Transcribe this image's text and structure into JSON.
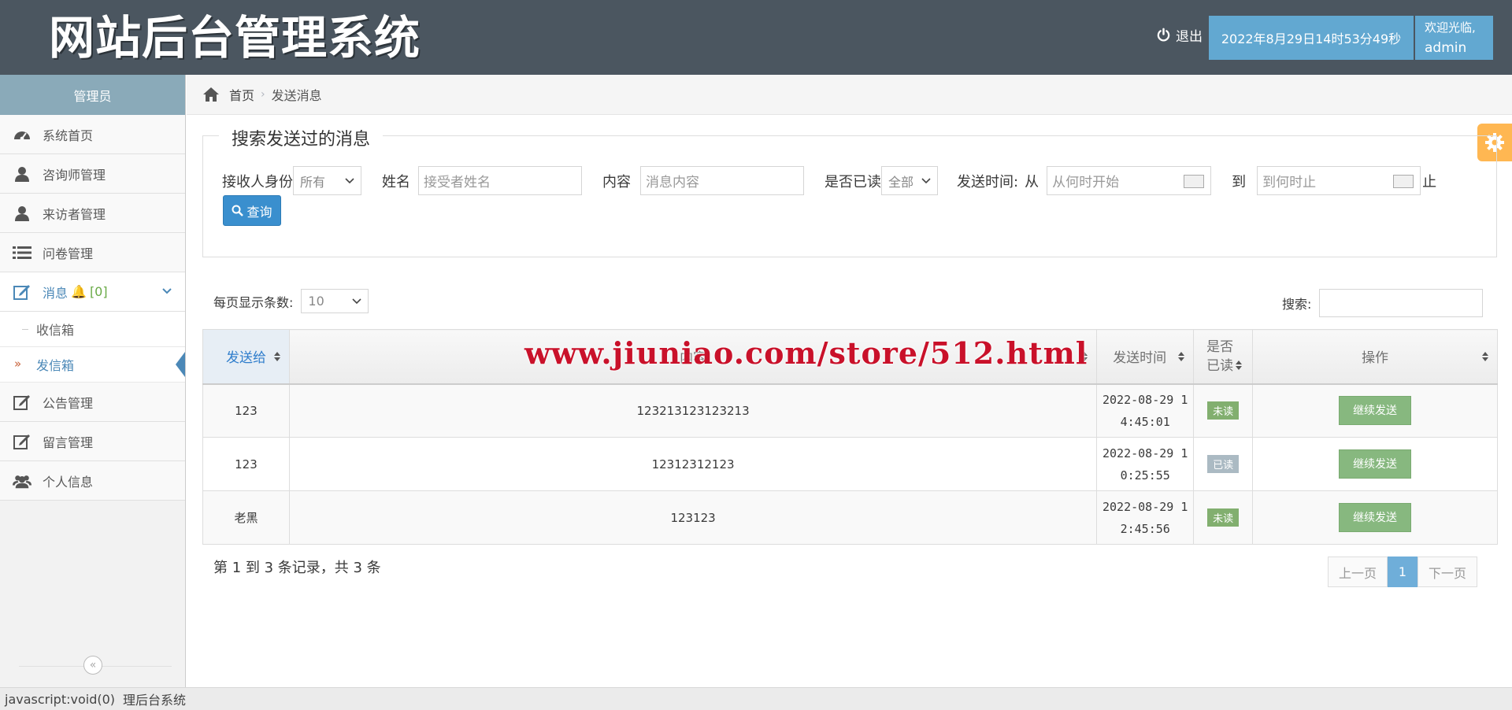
{
  "header": {
    "title": "网站后台管理系统",
    "logout_label": "退出",
    "datetime": "2022年8月29日14时53分49秒",
    "welcome": "欢迎光临,",
    "username": "admin"
  },
  "sidebar": {
    "role": "管理员",
    "items": [
      {
        "label": "系统首页",
        "icon": "dashboard-icon"
      },
      {
        "label": "咨询师管理",
        "icon": "user-icon"
      },
      {
        "label": "来访者管理",
        "icon": "user-icon"
      },
      {
        "label": "问卷管理",
        "icon": "list-icon"
      },
      {
        "label": "消息",
        "badge": "[0]",
        "icon": "edit-icon"
      },
      {
        "label": "公告管理",
        "icon": "edit-icon"
      },
      {
        "label": "留言管理",
        "icon": "edit-icon"
      },
      {
        "label": "个人信息",
        "icon": "users-icon"
      }
    ],
    "subitems": [
      {
        "label": "收信箱"
      },
      {
        "label": "发信箱"
      }
    ],
    "bell_glyph": "🔔"
  },
  "breadcrumb": {
    "home": "首页",
    "current": "发送消息"
  },
  "search_panel": {
    "legend": "搜索发送过的消息",
    "role_label": "接收人身份",
    "role_value": "所有",
    "name_label": "姓名",
    "name_placeholder": "接受者姓名",
    "content_label": "内容",
    "content_placeholder": "消息内容",
    "read_label": "是否已读",
    "read_value": "全部",
    "time_label": "发送时间:",
    "from_label": "从",
    "from_placeholder": "从何时开始",
    "to_label": "到",
    "to_placeholder": "到何时止",
    "end_label": "止",
    "query_label": "查询"
  },
  "table_controls": {
    "pagesize_label": "每页显示条数:",
    "pagesize_value": "10",
    "search_label": "搜索:"
  },
  "table": {
    "headers": [
      "发送给",
      "内容",
      "发送时间",
      "是否已读",
      "操作"
    ],
    "rows": [
      {
        "to": "123",
        "content": "123213123123213",
        "time1": "2022-08-29 1",
        "time2": "4:45:01",
        "status": "未读",
        "action": "继续发送"
      },
      {
        "to": "123",
        "content": "12312312123",
        "time1": "2022-08-29 1",
        "time2": "0:25:55",
        "status": "已读",
        "action": "继续发送"
      },
      {
        "to": "老黑",
        "content": "123123",
        "time1": "2022-08-29 1",
        "time2": "2:45:56",
        "status": "未读",
        "action": "继续发送"
      }
    ]
  },
  "footer": {
    "records": "第 1 到 3 条记录，共 3 条",
    "prev": "上一页",
    "current_page": "1",
    "next": "下一页"
  },
  "watermark": "www.jiuniao.com/store/512.html",
  "statusbar": {
    "link": "javascript:void(0)",
    "title": "理后台系统"
  },
  "colors": {
    "topbar": "#4b5660",
    "accent": "#62a8d1",
    "unread": "#82af6f",
    "read": "#abbac3",
    "resend": "#87b87f",
    "settings": "#ffb752"
  }
}
